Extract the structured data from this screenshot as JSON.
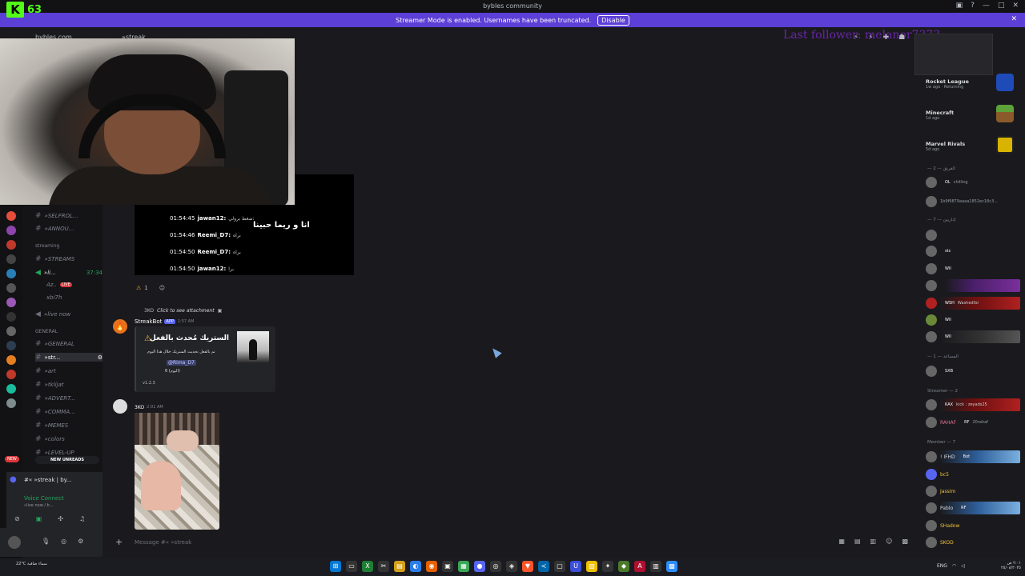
{
  "titlebar": {
    "title": "bybles community"
  },
  "kick": {
    "logo": "K",
    "count": "63"
  },
  "banner": {
    "text": "Streamer Mode is enabled. Usernames have been truncated.",
    "disable_label": "Disable"
  },
  "header": {
    "server": "bybles.com",
    "channel": "»streak",
    "last_follower": "Last follower: melanor7373"
  },
  "sidebar": {
    "channels_top": [
      {
        "label": "»SELFROL..."
      },
      {
        "label": "»ANNOU..."
      }
    ],
    "cat_streaming": "streaming",
    "streams": {
      "label": "»STREAMS"
    },
    "voice": {
      "label": "»li...",
      "timer": "37:34"
    },
    "voice_users": [
      {
        "name": "Az..",
        "live": "LIVE"
      },
      {
        "name": "xbi7h"
      }
    ],
    "live_now": {
      "label": "»live now"
    },
    "cat_general": "GENERAL",
    "general": {
      "label": "»GENERAL"
    },
    "streak": {
      "label": "»str..."
    },
    "others": [
      {
        "label": "»art"
      },
      {
        "label": "»tklijat"
      },
      {
        "label": "»ADVERT..."
      },
      {
        "label": "»COMMA..."
      },
      {
        "label": "»MEMES"
      },
      {
        "label": "»colors"
      },
      {
        "label": "»LEVEL-UP"
      }
    ],
    "new_pill": "NEW",
    "new_unreads": "NEW UNREADS",
    "now_channel": "#« »streak | by...",
    "voice_connect": "Voice Connect",
    "voice_sub": "»live now / b..."
  },
  "video_embed": {
    "caption": "انا و ريما حبينا",
    "lines": [
      {
        "time": "01:54:45",
        "name": "jawan12:",
        "text": "ضغط برولي:"
      },
      {
        "time": "01:54:46",
        "name": "Reemi_D7:",
        "text": "براه"
      },
      {
        "time": "01:54:50",
        "name": "Reemi_D7:",
        "text": "براه"
      },
      {
        "time": "01:54:50",
        "name": "jawan12:",
        "text": "برا"
      }
    ]
  },
  "reaction": {
    "emoji": "⚠",
    "count": "1"
  },
  "reply": {
    "badge": "3KO",
    "click": "Click to see attachment"
  },
  "bot": {
    "name": "StreakBot",
    "app": "APP",
    "time": "1:57 AM",
    "title": "الستريك مُحدث بالفعل",
    "desc": "تم بالفعل تحديث الستريك خلال هذا اليوم",
    "mention": "@Rima_D7",
    "day": "6 (اليوم)",
    "version": "v1.2.3"
  },
  "msg3": {
    "badge": "3KO",
    "time": "2:01 AM"
  },
  "composer": {
    "placeholder": "Message #« »streak"
  },
  "members": {
    "games": [
      {
        "name": "Rocket League",
        "sub": "1w ago · Returning"
      },
      {
        "name": "Minecraft",
        "sub": "1d ago"
      },
      {
        "name": "Marvel Rivals",
        "sub": "5d ago"
      }
    ],
    "cat1": "— الفريق — 2",
    "cat2": "— إداريين — 7",
    "cat3": "— المساعد — 1",
    "cat_streamer": "Streamer — 2",
    "cat_member": "Member — 7",
    "list1": [
      {
        "tag": "OL",
        "sub": "chilling"
      },
      {
        "tag": "",
        "sub": "1b9f9879aaaa1852ec18c3..."
      }
    ],
    "list2": [
      {
        "tag": "stc",
        "sub": ""
      },
      {
        "tag": "WII",
        "sub": ""
      },
      {
        "tag": "",
        "sub": ""
      },
      {
        "tag": "WSH",
        "sub": "Washedfor"
      },
      {
        "tag": "WII",
        "sub": ""
      },
      {
        "tag": "WII",
        "sub": ""
      }
    ],
    "list3": [
      {
        "tag": "SXB"
      }
    ],
    "streamers": [
      {
        "tag": "KAX",
        "sub": "kick : zeyads25"
      },
      {
        "name": "RAHAF",
        "tag": "RF",
        "sub": "20rahaf"
      }
    ],
    "members_list": [
      {
        "name": "! IFHD",
        "tag": "Bot"
      },
      {
        "name": "bc5"
      },
      {
        "name": "Jassim"
      },
      {
        "name": "Pablo",
        "tag": "RF"
      },
      {
        "name": "SHadow"
      },
      {
        "name": "SKOD"
      }
    ]
  },
  "taskbar": {
    "weather": "22°C سماء صافية",
    "lang": "ENG",
    "time": "٢:٠١ ص",
    "date": "٢٥/٠٨/٢٠٢٥"
  },
  "colors": {
    "accent": "#5b3fd6",
    "kick": "#53fc18",
    "live": "#da373c",
    "online": "#23a55a"
  }
}
